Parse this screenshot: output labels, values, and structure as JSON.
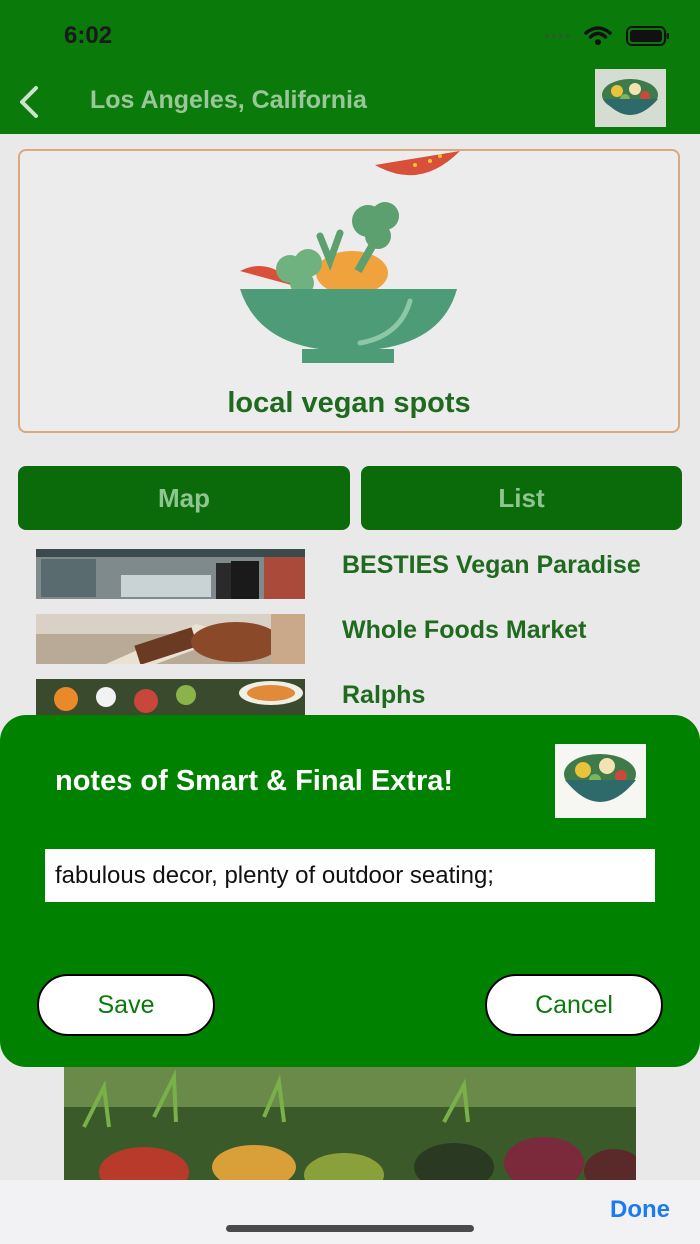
{
  "status_bar": {
    "time": "6:02"
  },
  "nav": {
    "title": "Los Angeles, California"
  },
  "hero": {
    "title": "local vegan spots"
  },
  "tabs": {
    "map": "Map",
    "list": "List"
  },
  "places": [
    {
      "name": "BESTIES Vegan Paradise"
    },
    {
      "name": "Whole Foods Market"
    },
    {
      "name": "Ralphs"
    }
  ],
  "dialog": {
    "title": "notes of Smart & Final Extra!",
    "note_value": "fabulous decor, plenty of outdoor seating;",
    "save_label": "Save",
    "cancel_label": "Cancel"
  },
  "keyboard_accessory": {
    "done_label": "Done"
  },
  "colors": {
    "brand_green": "#0a7a0a",
    "dialog_green": "#008200",
    "link_blue": "#1a7cf0"
  },
  "icons": {
    "back": "chevron-left-icon",
    "wifi": "wifi-icon",
    "battery": "battery-icon",
    "signal": "signal-icon",
    "salad": "salad-bowl-icon"
  }
}
